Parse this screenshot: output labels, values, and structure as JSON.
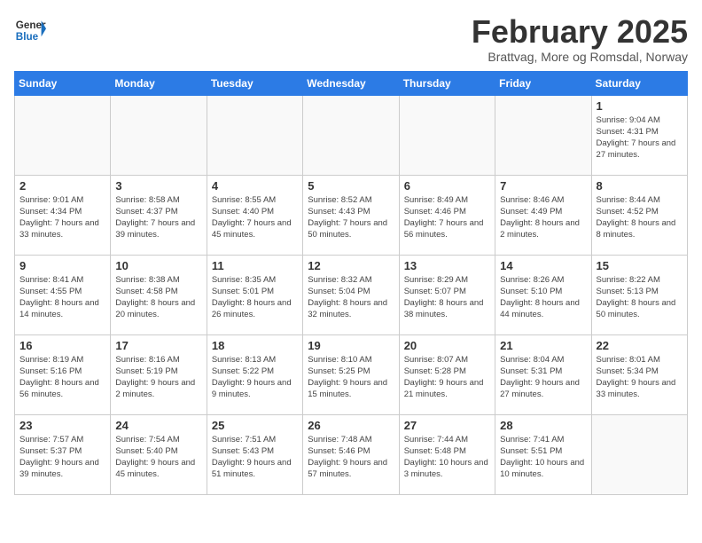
{
  "header": {
    "logo_general": "General",
    "logo_blue": "Blue",
    "month_title": "February 2025",
    "subtitle": "Brattvag, More og Romsdal, Norway"
  },
  "weekdays": [
    "Sunday",
    "Monday",
    "Tuesday",
    "Wednesday",
    "Thursday",
    "Friday",
    "Saturday"
  ],
  "weeks": [
    [
      {
        "day": "",
        "info": ""
      },
      {
        "day": "",
        "info": ""
      },
      {
        "day": "",
        "info": ""
      },
      {
        "day": "",
        "info": ""
      },
      {
        "day": "",
        "info": ""
      },
      {
        "day": "",
        "info": ""
      },
      {
        "day": "1",
        "info": "Sunrise: 9:04 AM\nSunset: 4:31 PM\nDaylight: 7 hours and 27 minutes."
      }
    ],
    [
      {
        "day": "2",
        "info": "Sunrise: 9:01 AM\nSunset: 4:34 PM\nDaylight: 7 hours and 33 minutes."
      },
      {
        "day": "3",
        "info": "Sunrise: 8:58 AM\nSunset: 4:37 PM\nDaylight: 7 hours and 39 minutes."
      },
      {
        "day": "4",
        "info": "Sunrise: 8:55 AM\nSunset: 4:40 PM\nDaylight: 7 hours and 45 minutes."
      },
      {
        "day": "5",
        "info": "Sunrise: 8:52 AM\nSunset: 4:43 PM\nDaylight: 7 hours and 50 minutes."
      },
      {
        "day": "6",
        "info": "Sunrise: 8:49 AM\nSunset: 4:46 PM\nDaylight: 7 hours and 56 minutes."
      },
      {
        "day": "7",
        "info": "Sunrise: 8:46 AM\nSunset: 4:49 PM\nDaylight: 8 hours and 2 minutes."
      },
      {
        "day": "8",
        "info": "Sunrise: 8:44 AM\nSunset: 4:52 PM\nDaylight: 8 hours and 8 minutes."
      }
    ],
    [
      {
        "day": "9",
        "info": "Sunrise: 8:41 AM\nSunset: 4:55 PM\nDaylight: 8 hours and 14 minutes."
      },
      {
        "day": "10",
        "info": "Sunrise: 8:38 AM\nSunset: 4:58 PM\nDaylight: 8 hours and 20 minutes."
      },
      {
        "day": "11",
        "info": "Sunrise: 8:35 AM\nSunset: 5:01 PM\nDaylight: 8 hours and 26 minutes."
      },
      {
        "day": "12",
        "info": "Sunrise: 8:32 AM\nSunset: 5:04 PM\nDaylight: 8 hours and 32 minutes."
      },
      {
        "day": "13",
        "info": "Sunrise: 8:29 AM\nSunset: 5:07 PM\nDaylight: 8 hours and 38 minutes."
      },
      {
        "day": "14",
        "info": "Sunrise: 8:26 AM\nSunset: 5:10 PM\nDaylight: 8 hours and 44 minutes."
      },
      {
        "day": "15",
        "info": "Sunrise: 8:22 AM\nSunset: 5:13 PM\nDaylight: 8 hours and 50 minutes."
      }
    ],
    [
      {
        "day": "16",
        "info": "Sunrise: 8:19 AM\nSunset: 5:16 PM\nDaylight: 8 hours and 56 minutes."
      },
      {
        "day": "17",
        "info": "Sunrise: 8:16 AM\nSunset: 5:19 PM\nDaylight: 9 hours and 2 minutes."
      },
      {
        "day": "18",
        "info": "Sunrise: 8:13 AM\nSunset: 5:22 PM\nDaylight: 9 hours and 9 minutes."
      },
      {
        "day": "19",
        "info": "Sunrise: 8:10 AM\nSunset: 5:25 PM\nDaylight: 9 hours and 15 minutes."
      },
      {
        "day": "20",
        "info": "Sunrise: 8:07 AM\nSunset: 5:28 PM\nDaylight: 9 hours and 21 minutes."
      },
      {
        "day": "21",
        "info": "Sunrise: 8:04 AM\nSunset: 5:31 PM\nDaylight: 9 hours and 27 minutes."
      },
      {
        "day": "22",
        "info": "Sunrise: 8:01 AM\nSunset: 5:34 PM\nDaylight: 9 hours and 33 minutes."
      }
    ],
    [
      {
        "day": "23",
        "info": "Sunrise: 7:57 AM\nSunset: 5:37 PM\nDaylight: 9 hours and 39 minutes."
      },
      {
        "day": "24",
        "info": "Sunrise: 7:54 AM\nSunset: 5:40 PM\nDaylight: 9 hours and 45 minutes."
      },
      {
        "day": "25",
        "info": "Sunrise: 7:51 AM\nSunset: 5:43 PM\nDaylight: 9 hours and 51 minutes."
      },
      {
        "day": "26",
        "info": "Sunrise: 7:48 AM\nSunset: 5:46 PM\nDaylight: 9 hours and 57 minutes."
      },
      {
        "day": "27",
        "info": "Sunrise: 7:44 AM\nSunset: 5:48 PM\nDaylight: 10 hours and 3 minutes."
      },
      {
        "day": "28",
        "info": "Sunrise: 7:41 AM\nSunset: 5:51 PM\nDaylight: 10 hours and 10 minutes."
      },
      {
        "day": "",
        "info": ""
      }
    ]
  ]
}
